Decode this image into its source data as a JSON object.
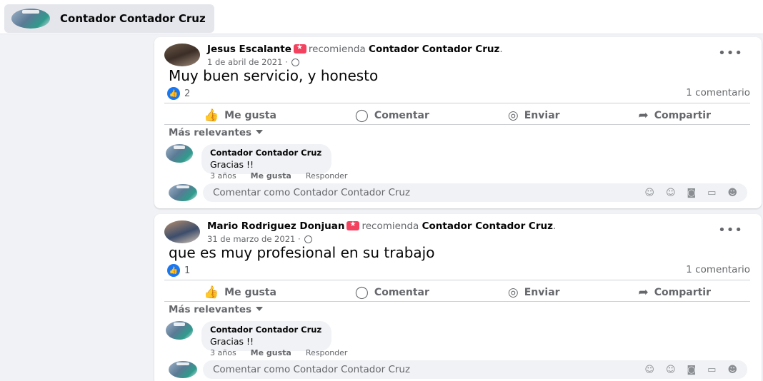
{
  "header": {
    "page_name": "Contador Contador Cruz"
  },
  "posts": [
    {
      "author": "Jesus Escalante",
      "action": "recomienda",
      "target": "Contador Contador Cruz",
      "date": "1 de abril de 2021 ·",
      "text": "Muy buen servicio, y honesto",
      "likes": "2",
      "comments": "1 comentario",
      "reply": {
        "author": "Contador Contador Cruz",
        "text": "Gracias !!",
        "time": "3 años",
        "like_label": "Me gusta",
        "reply_label": "Responder"
      }
    },
    {
      "author": "Mario Rodriguez Donjuan",
      "action": "recomienda",
      "target": "Contador Contador Cruz",
      "date": "31 de marzo de 2021 ·",
      "text": "que es muy profesional en su trabajo",
      "likes": "1",
      "comments": "1 comentario",
      "reply": {
        "author": "Contador Contador Cruz",
        "text": "Gracias !!",
        "time": "3 años",
        "like_label": "Me gusta",
        "reply_label": "Responder"
      }
    }
  ],
  "actions": {
    "like": "Me gusta",
    "comment": "Comentar",
    "send": "Enviar",
    "share": "Compartir"
  },
  "filter": "Más relevantes",
  "compose": {
    "placeholder": "Comentar como Contador Contador Cruz"
  },
  "icons": [
    "like-icon",
    "comment-icon",
    "messenger-icon",
    "share-icon",
    "avatar-icon",
    "emoji-icon",
    "camera-icon",
    "gif-icon",
    "sticker-icon",
    "more-icon",
    "globe-icon"
  ],
  "colors": {
    "accent": "#1877f2",
    "recommend": "#f3425f"
  }
}
